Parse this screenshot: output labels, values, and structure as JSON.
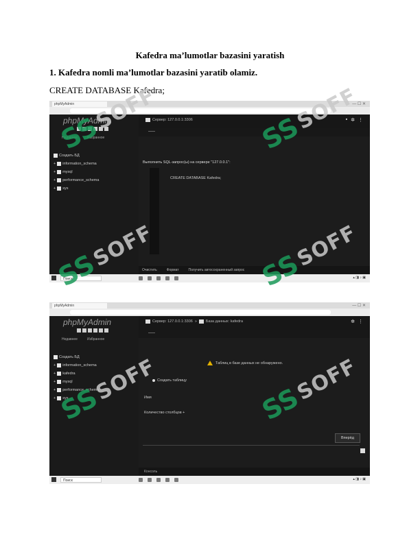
{
  "document": {
    "title": "Kafedra ma’lumotlar bazasini yaratish",
    "heading1": "1. Kafedra nomli ma’lumotlar bazasini yaratib olamiz.",
    "code": "CREATE DATABASE Kafedra;"
  },
  "screenshot1": {
    "app_logo": "phpMyAdmin",
    "sidebar_tabs": [
      "Недавнее",
      "Избранное"
    ],
    "breadcrumb": "Сервер: 127.0.0.1:3306",
    "db_tree": [
      "Создать БД",
      "information_schema",
      "mysql",
      "performance_schema",
      "sys"
    ],
    "info": "Выполнить SQL-запрос(ы) на сервере \"127.0.0.1\":",
    "sql": "CREATE DATABASE Kafedra;",
    "bottom_buttons": [
      "Очистить",
      "Формат",
      "Получить автосохраненный запрос"
    ],
    "taskbar_search": "Поиск"
  },
  "screenshot2": {
    "app_logo": "phpMyAdmin",
    "sidebar_tabs": [
      "Недавнее",
      "Избранное"
    ],
    "breadcrumb": "Сервер: 127.0.0.1:3306",
    "breadcrumb_db": "База данных: kafedra",
    "db_tree": [
      "Создать БД",
      "information_schema",
      "kafedra",
      "mysql",
      "performance_schema",
      "sys"
    ],
    "warning": "Таблиц в базе данных не обнаружено.",
    "create_label": "Создать таблицу",
    "name_label": "Имя",
    "collation_label": "Количество столбцов",
    "button": "Вперёд",
    "console": "Консоль",
    "taskbar_search": "Поиск"
  },
  "watermark": {
    "text": "SOFF",
    "mark": "SS",
    "color": "#1b9a5a"
  }
}
